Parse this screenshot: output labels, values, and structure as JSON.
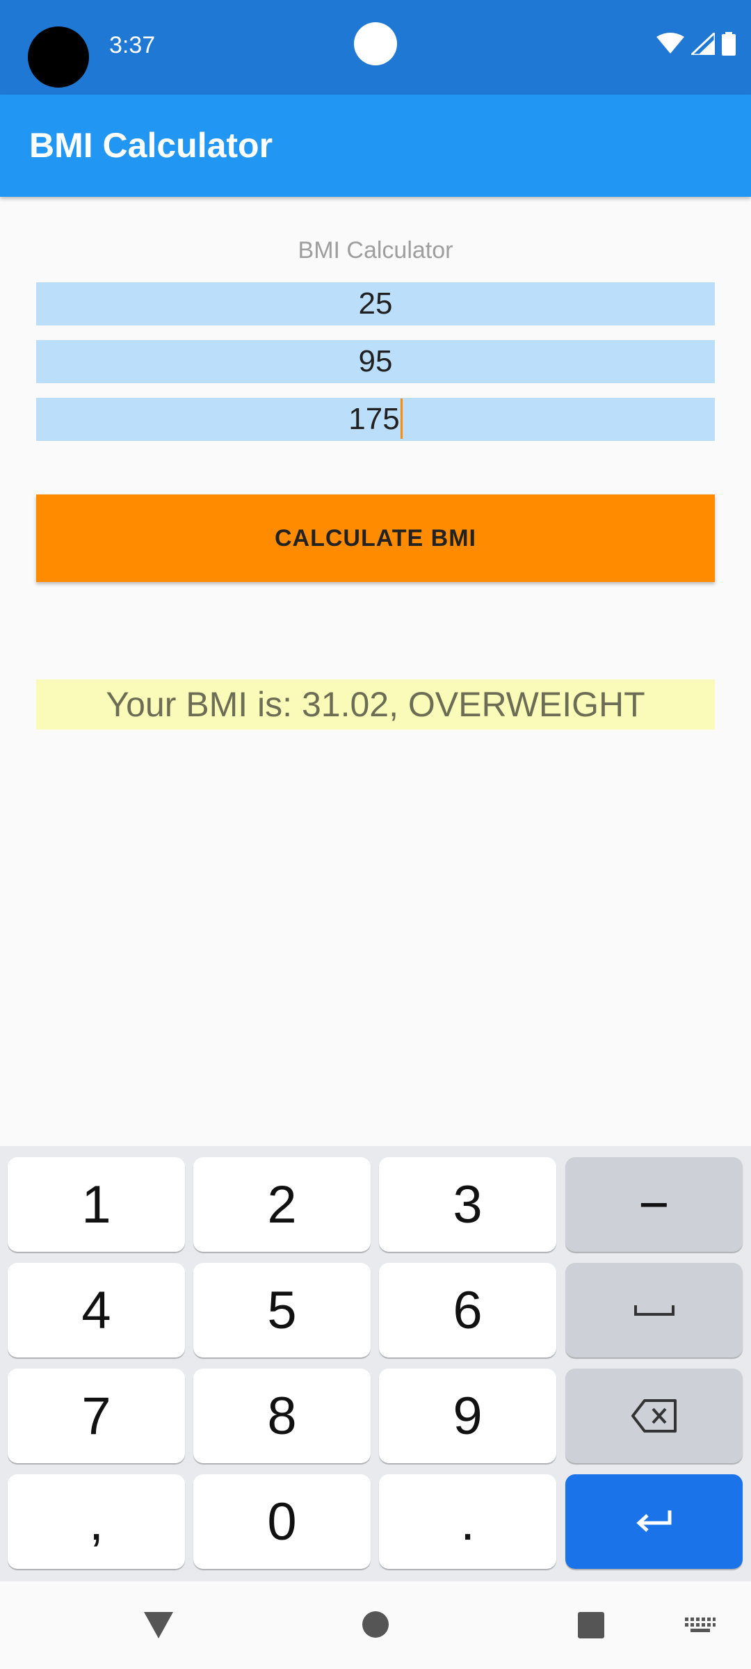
{
  "status_bar": {
    "time": "3:37",
    "icons": [
      "wifi-icon",
      "signal-icon",
      "battery-icon"
    ]
  },
  "app_bar": {
    "title": "BMI Calculator"
  },
  "form": {
    "heading": "BMI Calculator",
    "age_value": "25",
    "weight_value": "95",
    "height_value": "175",
    "button_label": "CALCULATE BMI",
    "result_text": "Your BMI is: 31.02, OVERWEIGHT"
  },
  "keyboard": {
    "rows": [
      [
        "1",
        "2",
        "3",
        "−"
      ],
      [
        "4",
        "5",
        "6",
        "space-icon"
      ],
      [
        "7",
        "8",
        "9",
        "backspace-icon"
      ],
      [
        ",",
        "0",
        ".",
        "enter-icon"
      ]
    ],
    "labels": {
      "k1": "1",
      "k2": "2",
      "k3": "3",
      "minus": "−",
      "k4": "4",
      "k5": "5",
      "k6": "6",
      "k7": "7",
      "k8": "8",
      "k9": "9",
      "comma": ",",
      "k0": "0",
      "period": "."
    }
  },
  "nav_bar": {
    "icons": [
      "back-icon",
      "home-icon",
      "recents-icon",
      "keyboard-switch-icon"
    ]
  },
  "colors": {
    "status_bar": "#1e78d4",
    "app_bar": "#2196f3",
    "field_bg": "#bbdefb",
    "button_bg": "#ff8c00",
    "result_bg": "#fafab9",
    "enter_key": "#1a73e8"
  }
}
